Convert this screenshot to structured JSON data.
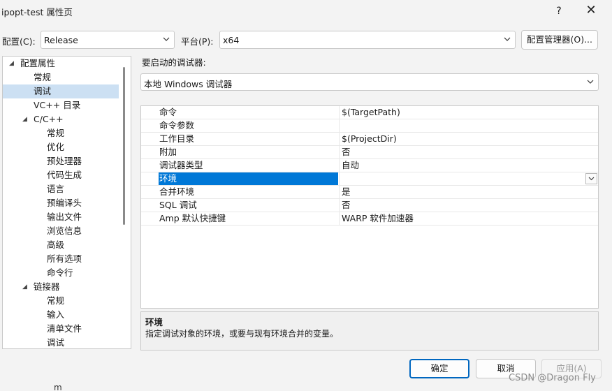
{
  "window": {
    "title": "ipopt-test 属性页",
    "help_icon": "?",
    "close_icon": "✕"
  },
  "toolbar": {
    "config_label": "配置(C):",
    "config_value": "Release",
    "platform_label": "平台(P):",
    "platform_value": "x64",
    "config_manager_label": "配置管理器(O)..."
  },
  "tree": {
    "items": [
      {
        "label": "配置属性",
        "level": 0,
        "expanded": true
      },
      {
        "label": "常规",
        "level": 1
      },
      {
        "label": "调试",
        "level": 1,
        "selected": true
      },
      {
        "label": "VC++ 目录",
        "level": 1
      },
      {
        "label": "C/C++",
        "level": 1,
        "expanded": true
      },
      {
        "label": "常规",
        "level": 2
      },
      {
        "label": "优化",
        "level": 2
      },
      {
        "label": "预处理器",
        "level": 2
      },
      {
        "label": "代码生成",
        "level": 2
      },
      {
        "label": "语言",
        "level": 2
      },
      {
        "label": "预编译头",
        "level": 2
      },
      {
        "label": "输出文件",
        "level": 2
      },
      {
        "label": "浏览信息",
        "level": 2
      },
      {
        "label": "高级",
        "level": 2
      },
      {
        "label": "所有选项",
        "level": 2
      },
      {
        "label": "命令行",
        "level": 2
      },
      {
        "label": "链接器",
        "level": 1,
        "expanded": true
      },
      {
        "label": "常规",
        "level": 2
      },
      {
        "label": "输入",
        "level": 2
      },
      {
        "label": "清单文件",
        "level": 2
      },
      {
        "label": "调试",
        "level": 2
      }
    ]
  },
  "debugger": {
    "heading": "要启动的调试器:",
    "value": "本地 Windows 调试器"
  },
  "properties": {
    "rows": [
      {
        "name": "命令",
        "value": "$(TargetPath)"
      },
      {
        "name": "命令参数",
        "value": ""
      },
      {
        "name": "工作目录",
        "value": "$(ProjectDir)"
      },
      {
        "name": "附加",
        "value": "否"
      },
      {
        "name": "调试器类型",
        "value": "自动"
      },
      {
        "name": "环境",
        "value": "",
        "selected": true
      },
      {
        "name": "合并环境",
        "value": "是"
      },
      {
        "name": "SQL 调试",
        "value": "否"
      },
      {
        "name": "Amp 默认快捷键",
        "value": "WARP 软件加速器"
      }
    ]
  },
  "description": {
    "title": "环境",
    "text": "指定调试对象的环境，或要与现有环境合并的变量。"
  },
  "buttons": {
    "ok": "确定",
    "cancel": "取消",
    "apply": "应用(A)"
  },
  "watermark": "CSDN @Dragon Fly",
  "stray_text": "m"
}
